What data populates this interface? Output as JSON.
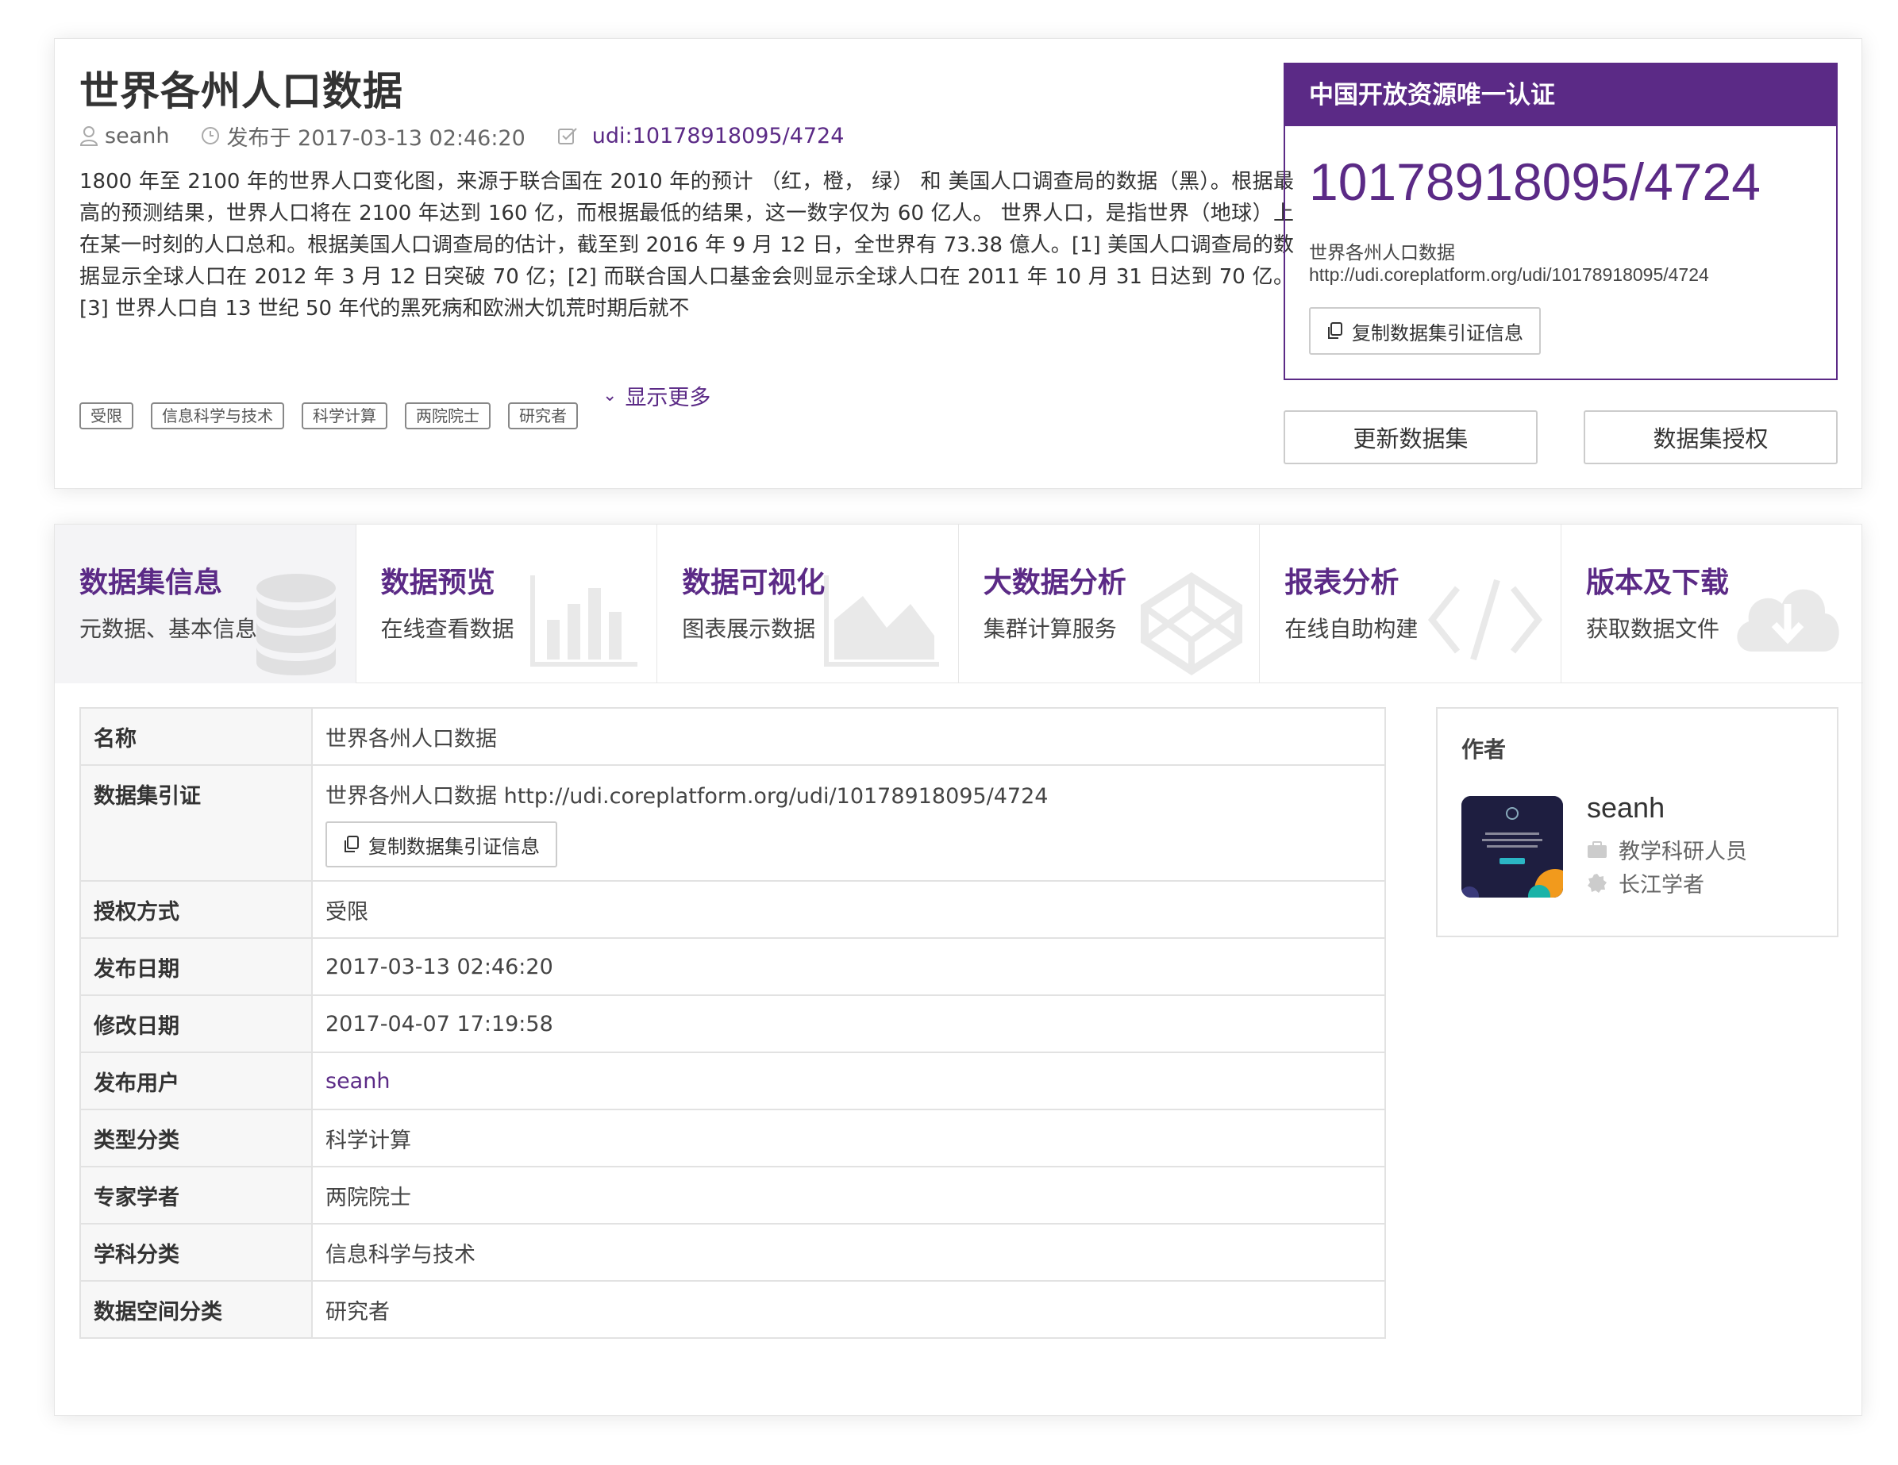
{
  "dataset": {
    "title": "世界各州人口数据",
    "author": "seanh",
    "published": "发布于 2017-03-13 02:46:20",
    "udi": "udi:10178918095/4724",
    "description": "1800 年至 2100 年的世界人口变化图，来源于联合国在 2010 年的预计 （红，橙， 绿） 和 美国人口调查局的数据（黑）。根据最高的预测结果，世界人口将在 2100 年达到 160 亿，而根据最低的结果，这一数字仅为 60 亿人。 世界人口，是指世界（地球）上在某一时刻的人口总和。根据美国人口调查局的估计，截至到 2016 年 9 月 12 日，全世界有 73.38 億人。[1] 美国人口调查局的数据显示全球人口在 2012 年 3 月 12 日突破 70 亿；[2] 而联合国人口基金会则显示全球人口在 2011 年 10 月 31 日达到 70 亿。[3] 世界人口自 13 世纪 50 年代的黑死病和欧洲大饥荒时期后就不",
    "show_more": "显示更多",
    "tags": [
      "受限",
      "信息科学与技术",
      "科学计算",
      "两院院士",
      "研究者"
    ]
  },
  "certification": {
    "header": "中国开放资源唯一认证",
    "number": "10178918095/4724",
    "name": "世界各州人口数据",
    "url": "http://udi.coreplatform.org/udi/10178918095/4724",
    "copy_label": "复制数据集引证信息"
  },
  "actions": {
    "update_label": "更新数据集",
    "license_label": "数据集授权"
  },
  "tabs": [
    {
      "title": "数据集信息",
      "subtitle": "元数据、基本信息",
      "icon": "database-icon"
    },
    {
      "title": "数据预览",
      "subtitle": "在线查看数据",
      "icon": "bar-chart-icon"
    },
    {
      "title": "数据可视化",
      "subtitle": "图表展示数据",
      "icon": "area-chart-icon"
    },
    {
      "title": "大数据分析",
      "subtitle": "集群计算服务",
      "icon": "codepen-icon"
    },
    {
      "title": "报表分析",
      "subtitle": "在线自助构建",
      "icon": "code-icon"
    },
    {
      "title": "版本及下载",
      "subtitle": "获取数据文件",
      "icon": "cloud-download-icon"
    }
  ],
  "info": {
    "name_label": "名称",
    "name_value": "世界各州人口数据",
    "citation_label": "数据集引证",
    "citation_value": "世界各州人口数据 http://udi.coreplatform.org/udi/10178918095/4724",
    "copy_label": "复制数据集引证信息",
    "license_label": "授权方式",
    "license_value": "受限",
    "published_label": "发布日期",
    "published_value": "2017-03-13 02:46:20",
    "modified_label": "修改日期",
    "modified_value": "2017-04-07 17:19:58",
    "user_label": "发布用户",
    "user_value": "seanh",
    "type_label": "类型分类",
    "type_value": "科学计算",
    "expert_label": "专家学者",
    "expert_value": "两院院士",
    "subject_label": "学科分类",
    "subject_value": "信息科学与技术",
    "space_label": "数据空间分类",
    "space_value": "研究者"
  },
  "author_card": {
    "title": "作者",
    "name": "seanh",
    "role": "教学科研人员",
    "honor": "长江学者"
  },
  "colors": {
    "accent": "#5b2a86",
    "border": "#e2e2e2"
  }
}
